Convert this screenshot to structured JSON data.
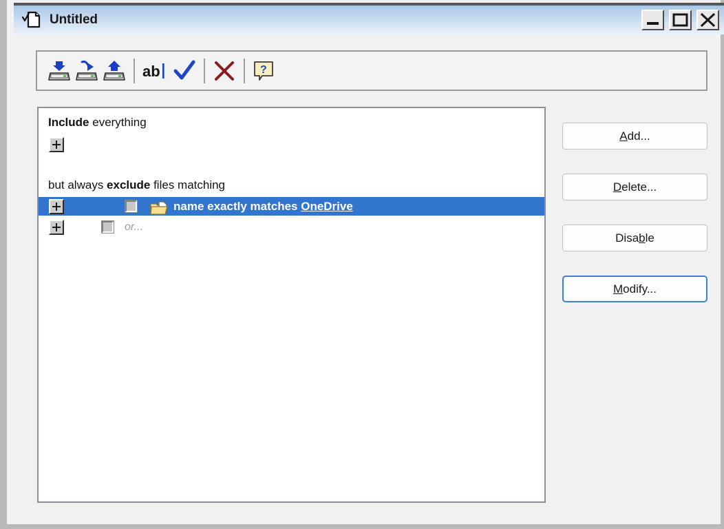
{
  "window": {
    "title": "Untitled",
    "icon": "document-check-icon",
    "controls": [
      {
        "name": "minimize",
        "glyph": "minimize-icon"
      },
      {
        "name": "maximize",
        "glyph": "maximize-icon"
      },
      {
        "name": "close",
        "glyph": "close-icon"
      }
    ]
  },
  "toolbar": {
    "buttons": [
      {
        "name": "import-from-disk",
        "icon": "disk-down-arrow-icon"
      },
      {
        "name": "save-to-disk",
        "icon": "disk-curved-arrow-icon"
      },
      {
        "name": "load-from-disk",
        "icon": "disk-up-arrow-icon"
      },
      {
        "name": "rename",
        "icon": "ab-text-cursor-icon",
        "label": "ab|"
      },
      {
        "name": "apply",
        "icon": "blue-checkmark-icon"
      },
      {
        "name": "delete",
        "icon": "red-x-icon"
      },
      {
        "name": "help",
        "icon": "help-balloon-icon",
        "label": "?"
      }
    ]
  },
  "rules": {
    "include_heading": {
      "strong": "Include",
      "rest": " everything"
    },
    "exclude_heading": {
      "pre": "but always ",
      "strong": "exclude",
      "post": " files matching"
    },
    "rows": [
      {
        "id": "exclude-rule-onedrive",
        "selected": true,
        "expander": "+",
        "checked": false,
        "icon": "folder-page-icon",
        "text": "name exactly matches ",
        "value": "OneDrive"
      },
      {
        "id": "exclude-rule-placeholder",
        "selected": false,
        "expander": "+",
        "checked": false,
        "icon": null,
        "text": "or...",
        "value": ""
      }
    ]
  },
  "side_buttons": [
    {
      "name": "add-button",
      "pre": "",
      "mnemonic": "A",
      "post": "dd..."
    },
    {
      "name": "delete-button",
      "pre": "",
      "mnemonic": "D",
      "post": "elete..."
    },
    {
      "name": "disable-button",
      "pre": "Disa",
      "mnemonic": "b",
      "post": "le"
    },
    {
      "name": "modify-button",
      "pre": "",
      "mnemonic": "M",
      "post": "odify...",
      "default": true
    }
  ],
  "colors": {
    "selection_blue": "#3275ce",
    "titlebar_blue": "#bcd3ec",
    "focus_border": "#3f7fd0",
    "dialog_bg": "#f1f1f1"
  }
}
